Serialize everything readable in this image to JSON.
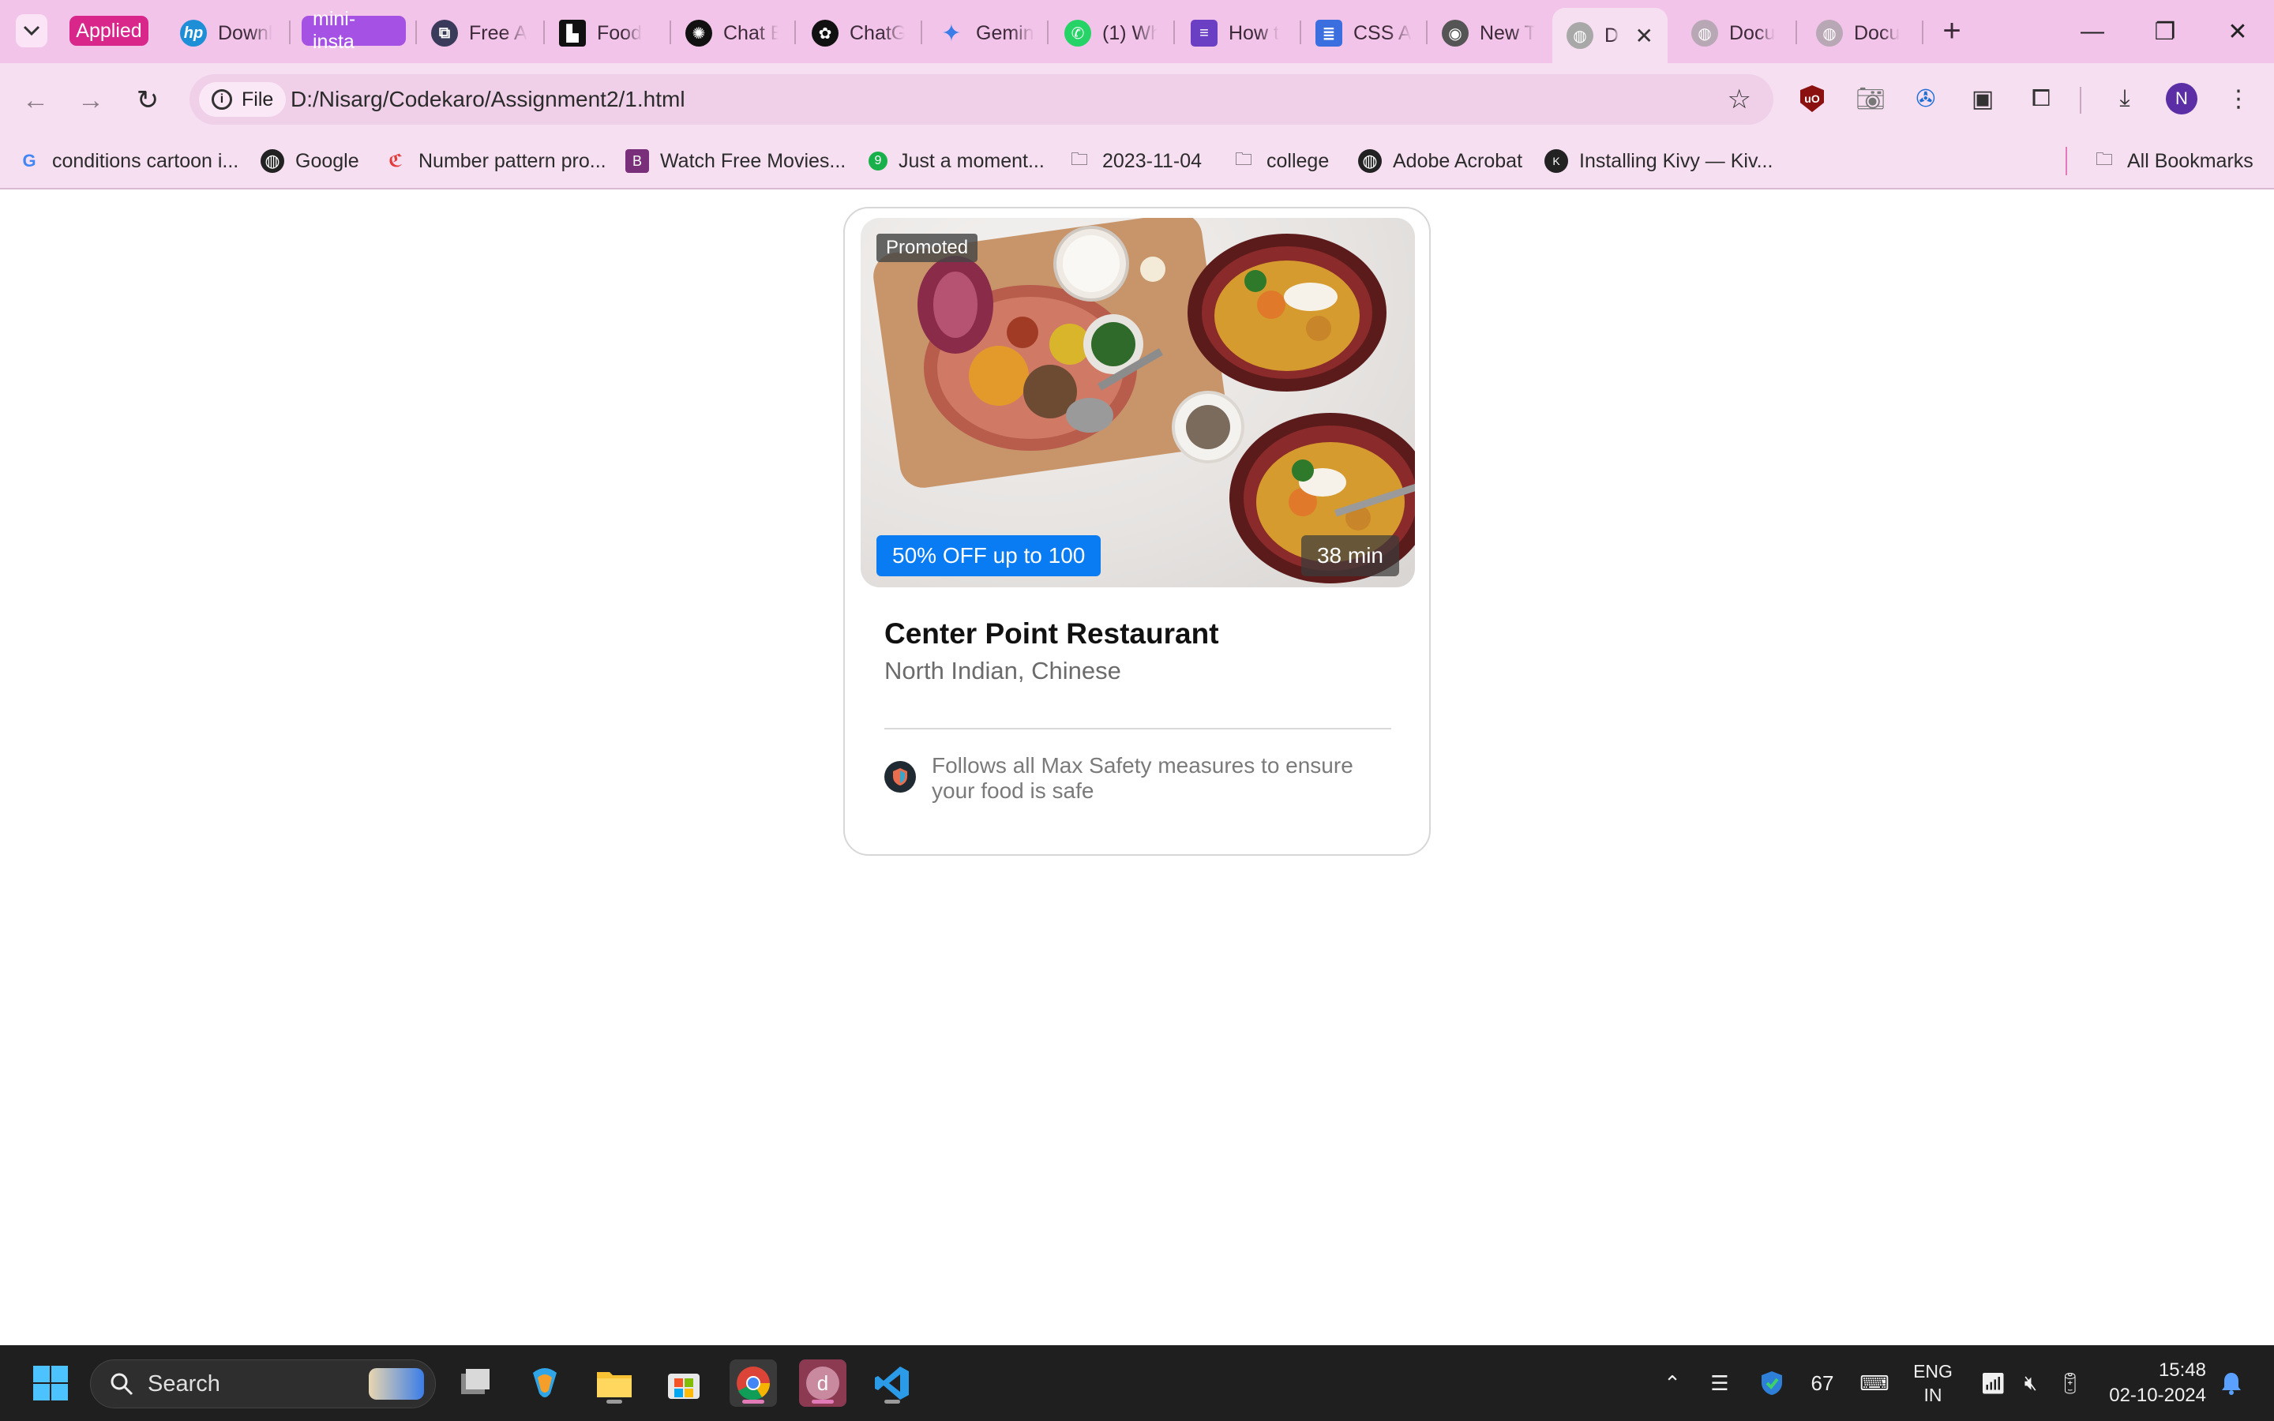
{
  "browser": {
    "tab_groups": [
      {
        "label": "Applied",
        "color": "#d9268a"
      },
      {
        "label": "mini-insta",
        "color": "#a551e3"
      }
    ],
    "tabs": [
      {
        "label": "Downl",
        "icon": "hp-icon"
      },
      {
        "label": "Free A",
        "icon": "free-app-icon"
      },
      {
        "label": "Food",
        "icon": "unstop-icon"
      },
      {
        "label": "Chat B",
        "icon": "chatbot-icon"
      },
      {
        "label": "ChatG",
        "icon": "chatgpt-icon"
      },
      {
        "label": "Gemin",
        "icon": "gemini-icon"
      },
      {
        "label": "(1) Wh",
        "icon": "whatsapp-icon"
      },
      {
        "label": "How t",
        "icon": "forms-icon"
      },
      {
        "label": "CSS A",
        "icon": "docs-icon"
      },
      {
        "label": "New T",
        "icon": "chrome-icon"
      },
      {
        "label": "D",
        "icon": "globe-icon",
        "active": true
      },
      {
        "label": "Docu",
        "icon": "globe-icon"
      },
      {
        "label": "Docu",
        "icon": "globe-icon"
      }
    ],
    "address": {
      "chip": "File",
      "url": "D:/Nisarg/Codekaro/Assignment2/1.html"
    },
    "profile_initial": "N",
    "bookmarks": [
      {
        "label": "conditions cartoon i...",
        "icon": "google-icon"
      },
      {
        "label": "Google",
        "icon": "globe-icon"
      },
      {
        "label": "Number pattern pro...",
        "icon": "codechef-icon"
      },
      {
        "label": "Watch Free Movies...",
        "icon": "bookmark-site-icon"
      },
      {
        "label": "Just a moment...",
        "icon": "site-9-icon"
      },
      {
        "label": "2023-11-04",
        "icon": "folder-icon"
      },
      {
        "label": "college",
        "icon": "folder-icon"
      },
      {
        "label": "Adobe Acrobat",
        "icon": "globe-icon"
      },
      {
        "label": "Installing Kivy — Kiv...",
        "icon": "kivy-icon"
      }
    ],
    "all_bookmarks": "All Bookmarks"
  },
  "card": {
    "promoted": "Promoted",
    "offer": "50% OFF up to 100",
    "time": "38 min",
    "name": "Center Point Restaurant",
    "cuisine": "North Indian, Chinese",
    "safety": "Follows all Max Safety measures to ensure your food is safe",
    "offer_color": "#0a7cf3"
  },
  "taskbar": {
    "search": "Search",
    "temperature": "67",
    "lang_line1": "ENG",
    "lang_line2": "IN",
    "time": "15:48",
    "date": "02-10-2024"
  }
}
